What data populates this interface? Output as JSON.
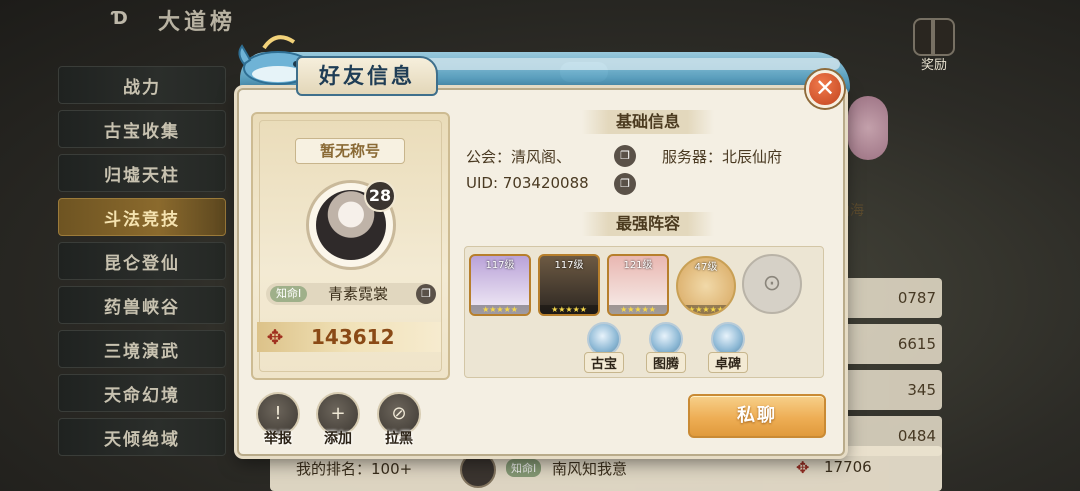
{
  "background": {
    "title": "大道榜",
    "reward_label": "奖励",
    "menu": [
      {
        "label": "战力",
        "active": false
      },
      {
        "label": "古宝收集",
        "active": false
      },
      {
        "label": "归墟天柱",
        "active": false
      },
      {
        "label": "斗法竞技",
        "active": true
      },
      {
        "label": "昆仑登仙",
        "active": false
      },
      {
        "label": "药兽峡谷",
        "active": false
      },
      {
        "label": "三境演武",
        "active": false
      },
      {
        "label": "天命幻境",
        "active": false
      },
      {
        "label": "天倾绝域",
        "active": false
      }
    ],
    "partial_tag": "山海",
    "partial_values": [
      "0787",
      "6615",
      "345",
      "0484"
    ],
    "my_rank": {
      "label": "我的排名：100+",
      "tag": "知命I",
      "name": "南风知我意",
      "power": "17706"
    }
  },
  "dialog": {
    "title": "好友信息",
    "close_symbol": "✕",
    "profile": {
      "title_badge": "暂无称号",
      "level": "28",
      "realm_tag": "知命Ⅰ",
      "nickname": "青素霓裳",
      "power": "143612"
    },
    "basic_info_header": "基础信息",
    "guild_label": "公会：清风阁、",
    "server_label": "服务器：北辰仙府",
    "uid_label": "UID: 703420088",
    "lineup_header": "最强阵容",
    "heroes": [
      {
        "level": "117级",
        "stars": "★★★★★"
      },
      {
        "level": "117级",
        "stars": "★★★★★"
      },
      {
        "level": "121级",
        "stars": "★★★★★"
      },
      {
        "level": "47级",
        "stars": "★★★★★"
      }
    ],
    "empty_slot_symbol": "⊙",
    "relics": [
      "古宝",
      "图腾",
      "卓碑"
    ],
    "actions": {
      "report": "举报",
      "add": "添加",
      "block": "拉黑"
    },
    "private_chat": "私聊"
  }
}
